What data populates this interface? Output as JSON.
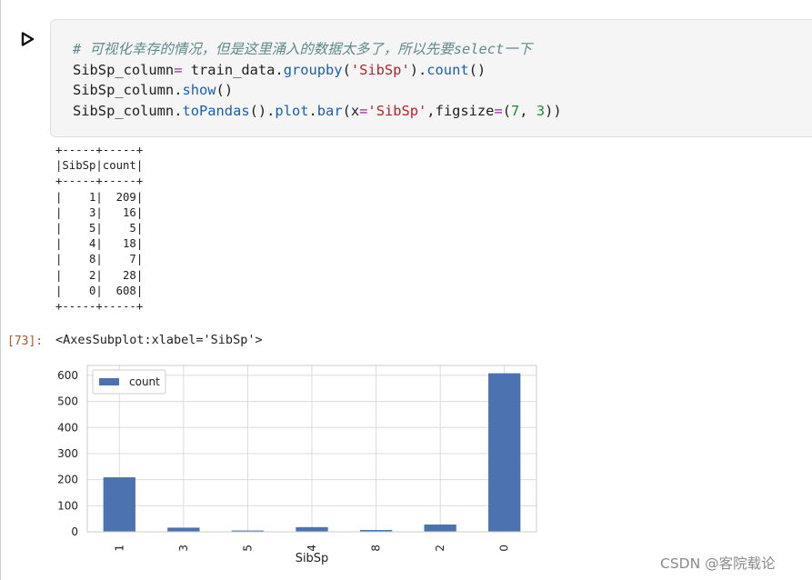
{
  "code_cell": {
    "comment": "# 可视化幸存的情况，但是这里涌入的数据太多了，所以先要select一下",
    "line2": {
      "a": "SibSp_column",
      "b": "=",
      "c": " train_data.",
      "d": "groupby",
      "e": "(",
      "f": "'SibSp'",
      "g": ").",
      "h": "count",
      "i": "()"
    },
    "line3": {
      "a": "SibSp_column.",
      "b": "show",
      "c": "()"
    },
    "line4": {
      "a": "SibSp_column.",
      "b": "toPandas",
      "c": "().",
      "d": "plot",
      "e": ".",
      "f": "bar",
      "g": "(x",
      "h": "=",
      "i": "'SibSp'",
      "j": ",figsize",
      "k": "=",
      "l": "(",
      "m": "7",
      "n": ", ",
      "o": "3",
      "p": "))"
    }
  },
  "table_output": "+-----+-----+\n|SibSp|count|\n+-----+-----+\n|    1|  209|\n|    3|   16|\n|    5|    5|\n|    4|   18|\n|    8|    7|\n|    2|   28|\n|    0|  608|\n+-----+-----+",
  "exec_count": "[73]:",
  "axes_repr": "<AxesSubplot:xlabel='SibSp'>",
  "chart_data": {
    "type": "bar",
    "categories": [
      "1",
      "3",
      "5",
      "4",
      "8",
      "2",
      "0"
    ],
    "series": [
      {
        "name": "count",
        "values": [
          209,
          16,
          5,
          18,
          7,
          28,
          608
        ]
      }
    ],
    "xlabel": "SibSp",
    "ylabel": "",
    "ylim": [
      0,
      638
    ],
    "yticks": [
      0,
      100,
      200,
      300,
      400,
      500,
      600
    ],
    "grid": true,
    "legend": "top-left",
    "bar_color": "#4c72b0"
  },
  "watermark": "CSDN @客院载论"
}
